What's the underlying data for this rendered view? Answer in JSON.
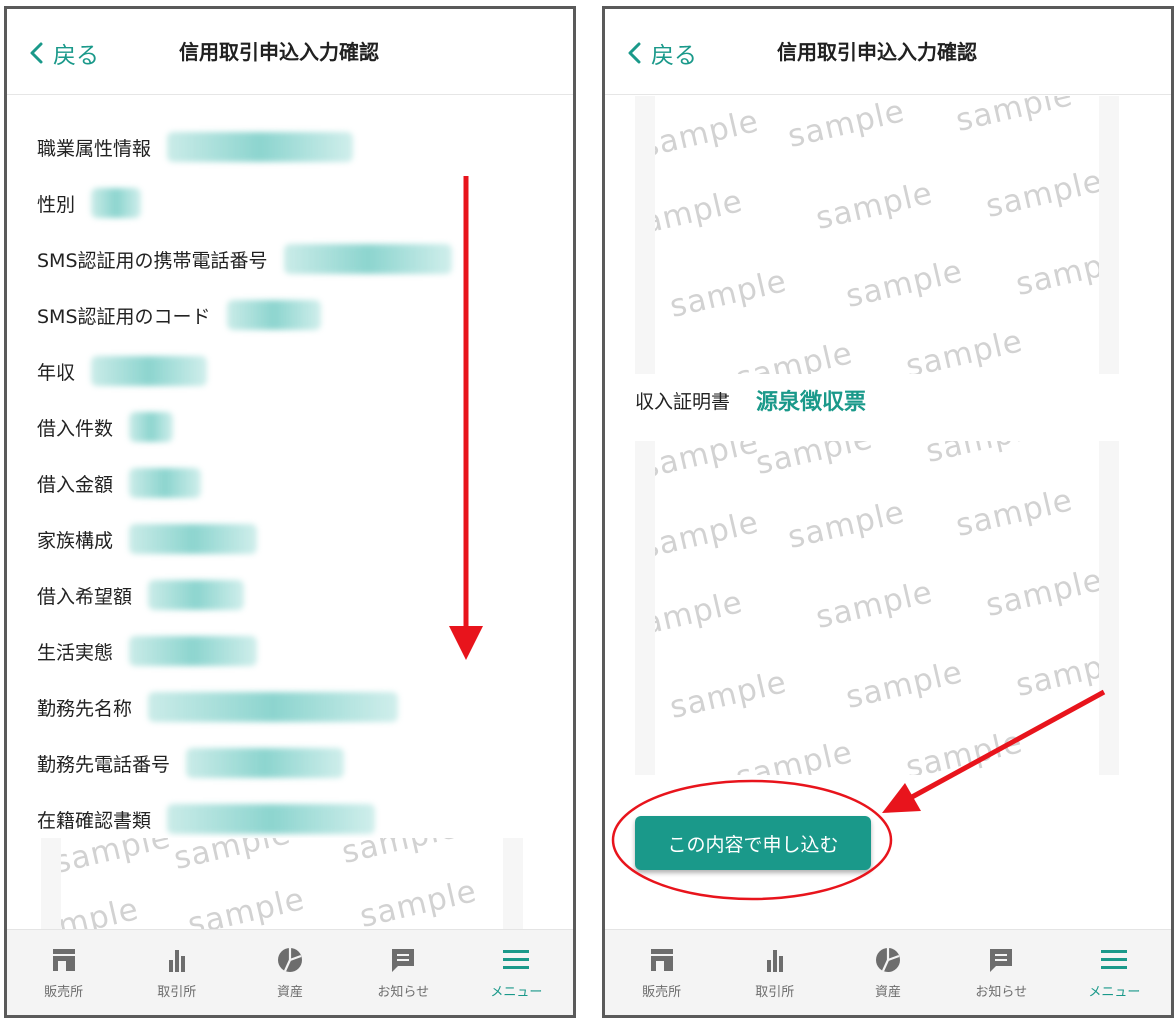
{
  "colors": {
    "accent": "#1a998a",
    "annotation": "#e8141c",
    "watermark": "#d2d2d2"
  },
  "left_screen": {
    "header": {
      "back_label": "戻る",
      "title": "信用取引申込入力確認"
    },
    "fields": [
      {
        "label": "職業属性情報"
      },
      {
        "label": "性別"
      },
      {
        "label": "SMS認証用の携帯電話番号"
      },
      {
        "label": "SMS認証用のコード"
      },
      {
        "label": "年収"
      },
      {
        "label": "借入件数"
      },
      {
        "label": "借入金額"
      },
      {
        "label": "家族構成"
      },
      {
        "label": "借入希望額"
      },
      {
        "label": "生活実態"
      },
      {
        "label": "勤務先名称"
      },
      {
        "label": "勤務先電話番号"
      },
      {
        "label": "在籍確認書類"
      }
    ]
  },
  "right_screen": {
    "header": {
      "back_label": "戻る",
      "title": "信用取引申込入力確認"
    },
    "income_proof": {
      "label": "収入証明書",
      "value": "源泉徴収票"
    },
    "submit_label": "この内容で申し込む"
  },
  "watermark_text": "sample",
  "tabbar": [
    {
      "label": "販売所",
      "icon": "store-icon"
    },
    {
      "label": "取引所",
      "icon": "bar-chart-icon"
    },
    {
      "label": "資産",
      "icon": "pie-chart-icon"
    },
    {
      "label": "お知らせ",
      "icon": "message-icon"
    },
    {
      "label": "メニュー",
      "icon": "hamburger-menu-icon",
      "active": true
    }
  ]
}
